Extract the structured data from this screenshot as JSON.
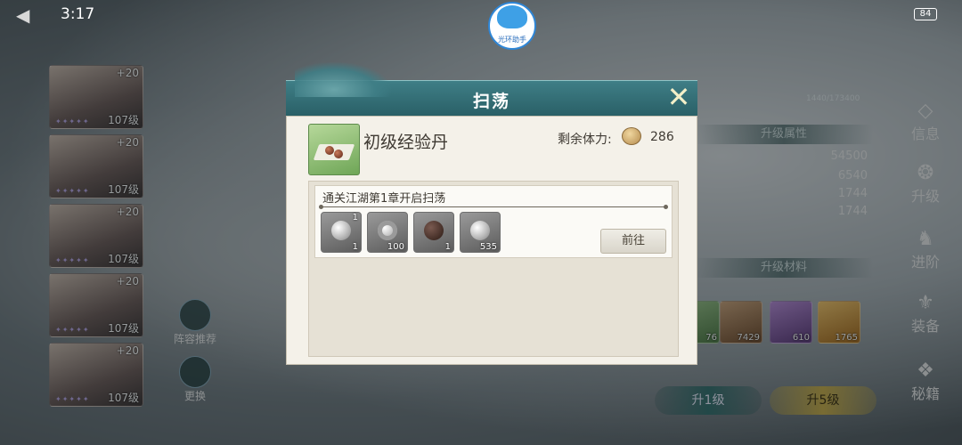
{
  "status": {
    "time": "3:17",
    "battery": "84"
  },
  "helper": {
    "label": "光环助手"
  },
  "roster": [
    {
      "plus": "+20",
      "level": "107级"
    },
    {
      "plus": "+20",
      "level": "107级"
    },
    {
      "plus": "+20",
      "level": "107级"
    },
    {
      "plus": "+20",
      "level": "107级"
    },
    {
      "plus": "+20",
      "level": "107级"
    }
  ],
  "side_buttons": {
    "lineup": "阵容推荐",
    "swap": "更换"
  },
  "right_panel": {
    "exp_progress": "1440/173400",
    "attr_header": "升级属性",
    "stats": [
      "54500",
      "6540",
      "1744",
      "1744"
    ],
    "material_header": "升级材料",
    "materials": [
      "76",
      "7429",
      "610",
      "1765"
    ],
    "buttons": {
      "up1": "升1级",
      "up5": "升5级"
    }
  },
  "right_nav": [
    {
      "label": "信息"
    },
    {
      "label": "升级"
    },
    {
      "label": "进阶"
    },
    {
      "label": "装备"
    },
    {
      "label": "秘籍"
    }
  ],
  "dialog": {
    "title": "扫荡",
    "item_name": "初级经验丹",
    "stamina_label": "剩余体力:",
    "stamina_value": "286",
    "stage": {
      "title": "通关江湖第1章开启扫荡",
      "rewards": [
        {
          "icon": "silver-ingot-icon",
          "badge": "1",
          "count": "1"
        },
        {
          "icon": "coin-icon",
          "count": "100"
        },
        {
          "icon": "exp-pill-icon",
          "count": "1"
        },
        {
          "icon": "pearl-icon",
          "count": "535"
        }
      ],
      "go_label": "前往"
    }
  }
}
